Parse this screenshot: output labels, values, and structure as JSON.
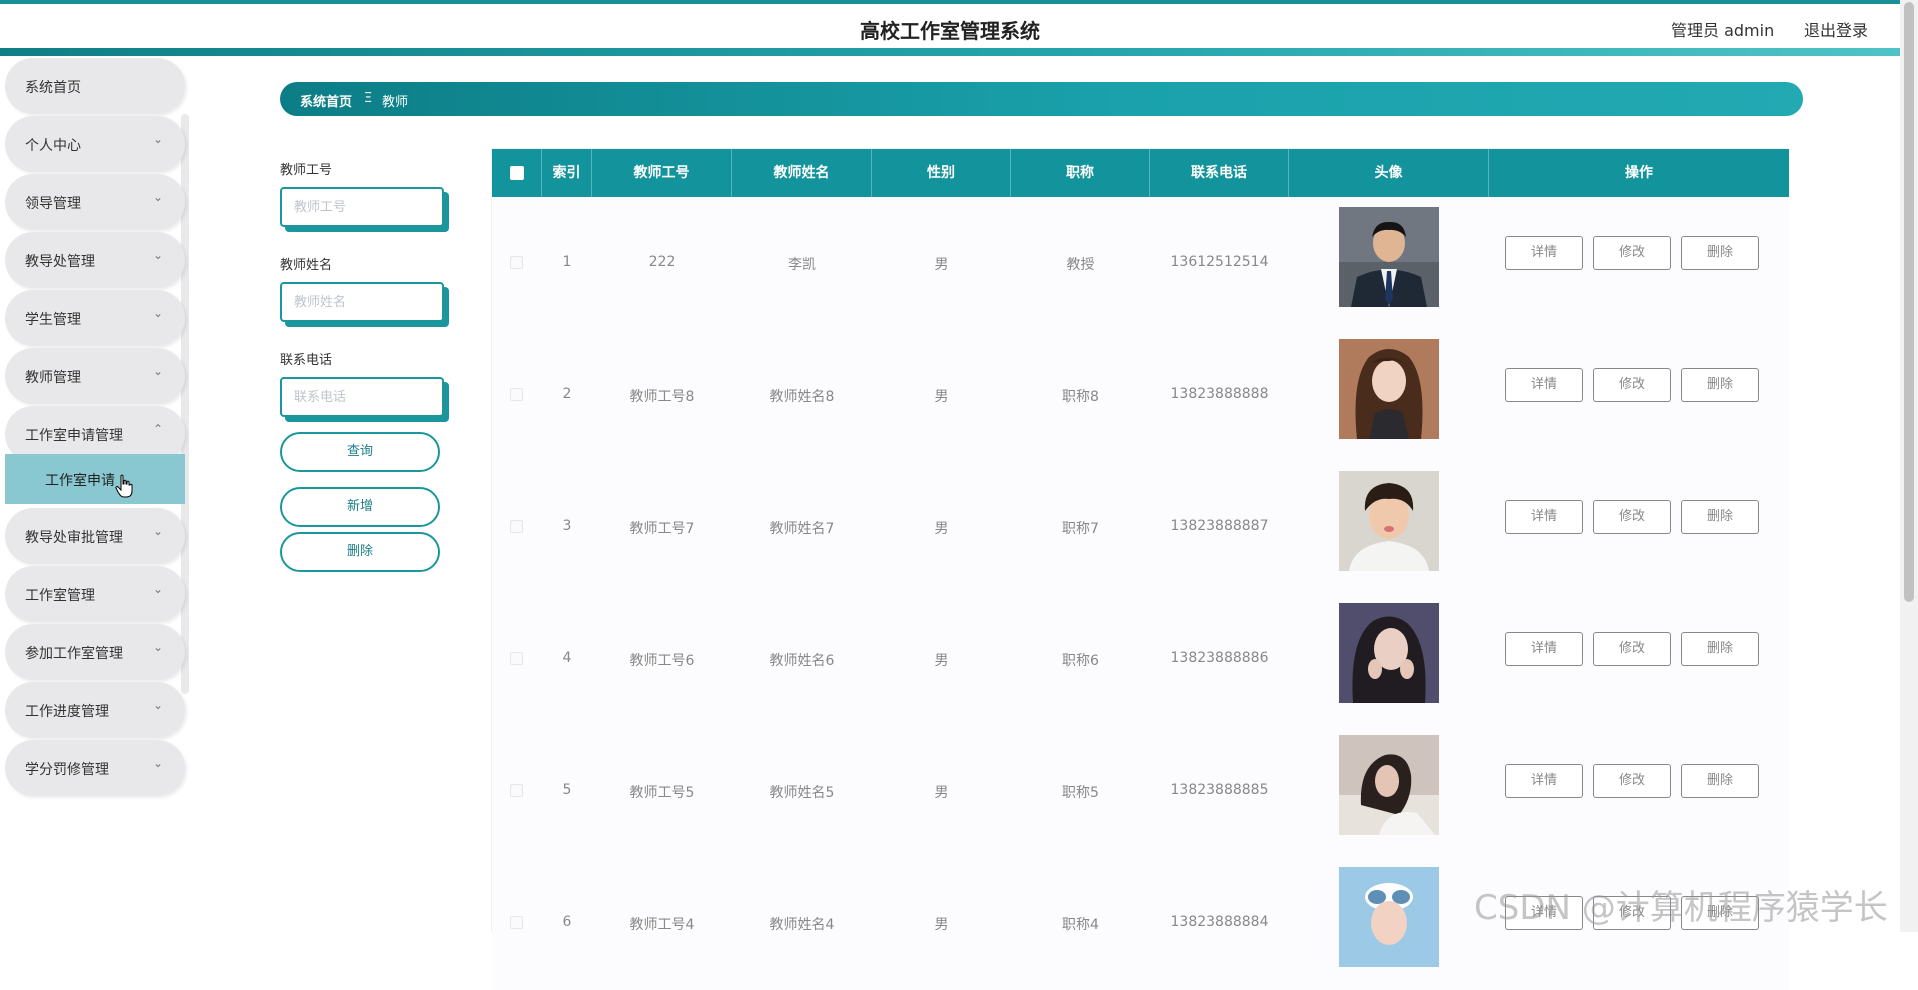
{
  "header": {
    "title": "高校工作室管理系统",
    "user": "管理员 admin",
    "logout": "退出登录"
  },
  "sidebar": {
    "items": [
      {
        "label": "系统首页",
        "chevron": false
      },
      {
        "label": "个人中心",
        "chevron": true
      },
      {
        "label": "领导管理",
        "chevron": true
      },
      {
        "label": "教导处管理",
        "chevron": true
      },
      {
        "label": "学生管理",
        "chevron": true
      },
      {
        "label": "教师管理",
        "chevron": true
      },
      {
        "label": "工作室申请管理",
        "chevron": true,
        "expanded": true
      },
      {
        "label": "教导处审批管理",
        "chevron": true
      },
      {
        "label": "工作室管理",
        "chevron": true
      },
      {
        "label": "参加工作室管理",
        "chevron": true
      },
      {
        "label": "工作进度管理",
        "chevron": true
      },
      {
        "label": "学分罚修管理",
        "chevron": true
      }
    ],
    "submenu_active": "工作室申请"
  },
  "breadcrumb": {
    "home": "系统首页",
    "separator": "Ξ",
    "current": "教师"
  },
  "search": {
    "teacher_no_label": "教师工号",
    "teacher_no_placeholder": "教师工号",
    "teacher_name_label": "教师姓名",
    "teacher_name_placeholder": "教师姓名",
    "phone_label": "联系电话",
    "phone_placeholder": "联系电话",
    "query_button": "查询",
    "add_button": "新增",
    "delete_button": "删除"
  },
  "table": {
    "columns": [
      "索引",
      "教师工号",
      "教师姓名",
      "性别",
      "职称",
      "联系电话",
      "头像",
      "操作"
    ],
    "rows": [
      {
        "index": "1",
        "teacher_no": "222",
        "name": "李凯",
        "gender": "男",
        "title": "教授",
        "phone": "13612512514",
        "avatar": "man-suit"
      },
      {
        "index": "2",
        "teacher_no": "教师工号8",
        "name": "教师姓名8",
        "gender": "男",
        "title": "职称8",
        "phone": "13823888888",
        "avatar": "woman-longhair"
      },
      {
        "index": "3",
        "teacher_no": "教师工号7",
        "name": "教师姓名7",
        "gender": "男",
        "title": "职称7",
        "phone": "13823888887",
        "avatar": "boy-whitehoodie"
      },
      {
        "index": "4",
        "teacher_no": "教师工号6",
        "name": "教师姓名6",
        "gender": "男",
        "title": "职称6",
        "phone": "13823888886",
        "avatar": "woman-darkhair"
      },
      {
        "index": "5",
        "teacher_no": "教师工号5",
        "name": "教师姓名5",
        "gender": "男",
        "title": "职称5",
        "phone": "13823888885",
        "avatar": "woman-lying"
      },
      {
        "index": "6",
        "teacher_no": "教师工号4",
        "name": "教师姓名4",
        "gender": "男",
        "title": "职称4",
        "phone": "13823888884",
        "avatar": "woman-goggles"
      }
    ],
    "actions": {
      "detail": "详情",
      "edit": "修改",
      "delete": "删除"
    }
  },
  "watermark": "CSDN @计算机程序猿学长",
  "colors": {
    "accent": "#13939b",
    "sidebar_active": "#89c8d0",
    "menu_bg": "#e8e8ea"
  }
}
